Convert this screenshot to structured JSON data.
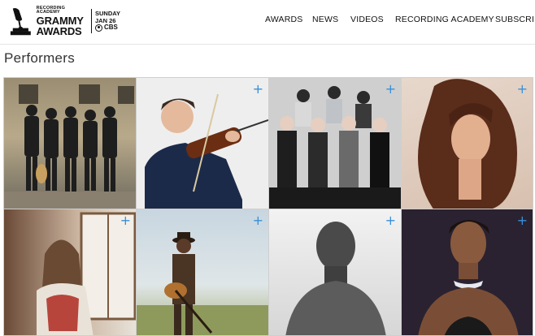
{
  "brand": {
    "small": "RECORDING ACADEMY",
    "line1": "GRAMMY",
    "line2": "AWARDS",
    "day": "SUNDAY",
    "date": "JAN 26",
    "network": "CBS"
  },
  "nav": {
    "items": [
      "AWARDS",
      "NEWS",
      "VIDEOS",
      "RECORDING ACADEMY",
      "SUBSCRIBE"
    ]
  },
  "page": {
    "title": "Performers"
  },
  "tiles": {
    "plus": "+",
    "items": [
      {
        "id": "band"
      },
      {
        "id": "violinist"
      },
      {
        "id": "group"
      },
      {
        "id": "curly-hair"
      },
      {
        "id": "window-singer"
      },
      {
        "id": "guitarist"
      },
      {
        "id": "man-bw"
      },
      {
        "id": "dancer"
      }
    ]
  },
  "colors": {
    "accent": "#3a8fd8"
  }
}
